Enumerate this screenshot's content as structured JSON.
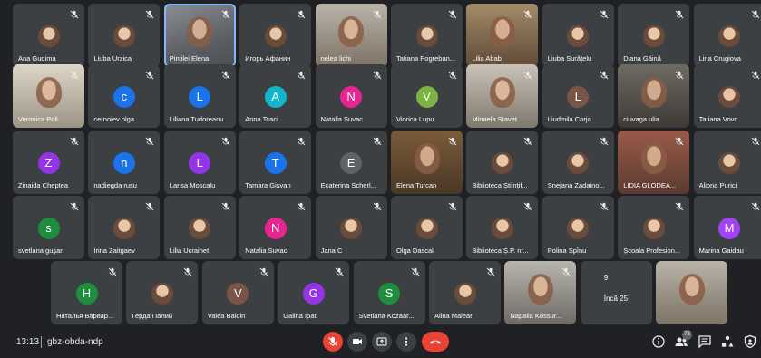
{
  "meeting": {
    "time": "13:13",
    "separator": "|",
    "code": "gbz-obda-ndp",
    "participant_count": "73"
  },
  "colors": {
    "tile": "#3c4043",
    "background": "#202124",
    "accent": "#8ab4f8",
    "danger": "#ea4335",
    "avatars": {
      "purple": "#9334e6",
      "blue": "#1a73e8",
      "teal": "#12b5cb",
      "pink": "#e52592",
      "green": "#34a853",
      "brown": "#795548",
      "slate": "#5f6368",
      "darkgreen": "#1e8e3e",
      "magenta": "#a142f4",
      "olive": "#7cb342",
      "orange": "#e8710a"
    }
  },
  "rows": [
    {
      "tiles": [
        {
          "name": "Ana Gudima",
          "kind": "photo"
        },
        {
          "name": "Liuba Urzica",
          "kind": "photo"
        },
        {
          "name": "Pintilei Elena",
          "kind": "video",
          "style": "v1",
          "active": true
        },
        {
          "name": "Игорь Афанин",
          "kind": "photo"
        },
        {
          "name": "nelea lichi",
          "kind": "video",
          "style": "v2"
        },
        {
          "name": "Tatiana Pogreban...",
          "kind": "photo"
        },
        {
          "name": "Lilia Abab",
          "kind": "video",
          "style": "v3"
        },
        {
          "name": "Liuba Surățelu",
          "kind": "photo"
        },
        {
          "name": "Diana Găină",
          "kind": "photo"
        },
        {
          "name": "Lina Crugiova",
          "kind": "photo"
        }
      ]
    },
    {
      "tiles": [
        {
          "name": "Veronica Poli",
          "kind": "video",
          "style": "v4"
        },
        {
          "name": "cernoiev olga",
          "kind": "initial",
          "initial": "c",
          "color": "blue"
        },
        {
          "name": "Liliana Tudoreanu",
          "kind": "initial",
          "initial": "L",
          "color": "blue"
        },
        {
          "name": "Anna Tcaci",
          "kind": "initial",
          "initial": "A",
          "color": "teal"
        },
        {
          "name": "Natalia Suvac",
          "kind": "initial",
          "initial": "N",
          "color": "pink"
        },
        {
          "name": "Viorica Lupu",
          "kind": "initial",
          "initial": "V",
          "color": "olive"
        },
        {
          "name": "Minaela Stavet",
          "kind": "video",
          "style": "v6"
        },
        {
          "name": "Liudmila Corja",
          "kind": "initial",
          "initial": "L",
          "color": "brown"
        },
        {
          "name": "ciuvaga ulia",
          "kind": "video",
          "style": "v7"
        },
        {
          "name": "Tatiana Vovc",
          "kind": "photo"
        }
      ]
    },
    {
      "tiles": [
        {
          "name": "Zinaida Cheptea",
          "kind": "initial",
          "initial": "Z",
          "color": "purple"
        },
        {
          "name": "nadiegda rusu",
          "kind": "initial",
          "initial": "n",
          "color": "blue"
        },
        {
          "name": "Larisa Moscalu",
          "kind": "initial",
          "initial": "L",
          "color": "purple"
        },
        {
          "name": "Tamara Gisvan",
          "kind": "initial",
          "initial": "T",
          "color": "blue"
        },
        {
          "name": "Ecaterina Scherl...",
          "kind": "initial",
          "initial": "E",
          "color": "slate"
        },
        {
          "name": "Elena Turcan",
          "kind": "video",
          "style": "v5"
        },
        {
          "name": "Biblioteca Științif...",
          "kind": "photo"
        },
        {
          "name": "Snejana Zadaino...",
          "kind": "photo"
        },
        {
          "name": "LIDIA GLODEA...",
          "kind": "video",
          "style": "v8"
        },
        {
          "name": "Aliona Purici",
          "kind": "photo"
        }
      ]
    },
    {
      "tiles": [
        {
          "name": "svetlana guşan",
          "kind": "initial",
          "initial": "s",
          "color": "darkgreen"
        },
        {
          "name": "Irina Zaitgaev",
          "kind": "photo"
        },
        {
          "name": "Lilia Ucrainet",
          "kind": "photo"
        },
        {
          "name": "Natalia Suvac",
          "kind": "initial",
          "initial": "N",
          "color": "pink"
        },
        {
          "name": "Jana C",
          "kind": "photo"
        },
        {
          "name": "Olga Dascal",
          "kind": "photo"
        },
        {
          "name": "Biblioteca Ș.P. nr...",
          "kind": "photo"
        },
        {
          "name": "Polina Spînu",
          "kind": "photo"
        },
        {
          "name": "Școala Profesion...",
          "kind": "photo"
        },
        {
          "name": "Marina Gaidau",
          "kind": "initial",
          "initial": "M",
          "color": "magenta"
        }
      ]
    },
    {
      "tiles": [
        {
          "name": "Наталья Варвар...",
          "kind": "initial",
          "initial": "H",
          "color": "darkgreen"
        },
        {
          "name": "Герда Палий",
          "kind": "photo"
        },
        {
          "name": "Valea Baldin",
          "kind": "initial",
          "initial": "V",
          "color": "brown"
        },
        {
          "name": "Galina Ipati",
          "kind": "initial",
          "initial": "G",
          "color": "purple"
        },
        {
          "name": "Svetlana Kozaar...",
          "kind": "initial",
          "initial": "S",
          "color": "darkgreen"
        },
        {
          "name": "Alina Malear",
          "kind": "photo"
        },
        {
          "name": "Napalia Kossur...",
          "kind": "video",
          "style": "v9"
        },
        {
          "name": "Încă 25",
          "kind": "more",
          "count": "9"
        },
        {
          "name": "",
          "kind": "video",
          "style": "v2"
        }
      ]
    }
  ],
  "controls": {
    "mic": {
      "label": "microphone-off"
    },
    "camera": {
      "label": "camera"
    },
    "present": {
      "label": "present-screen"
    },
    "more": {
      "label": "more-options"
    },
    "leave": {
      "label": "leave-call"
    }
  },
  "right_tools": [
    "info-icon",
    "people-icon",
    "chat-icon",
    "activities-icon",
    "security-icon"
  ]
}
